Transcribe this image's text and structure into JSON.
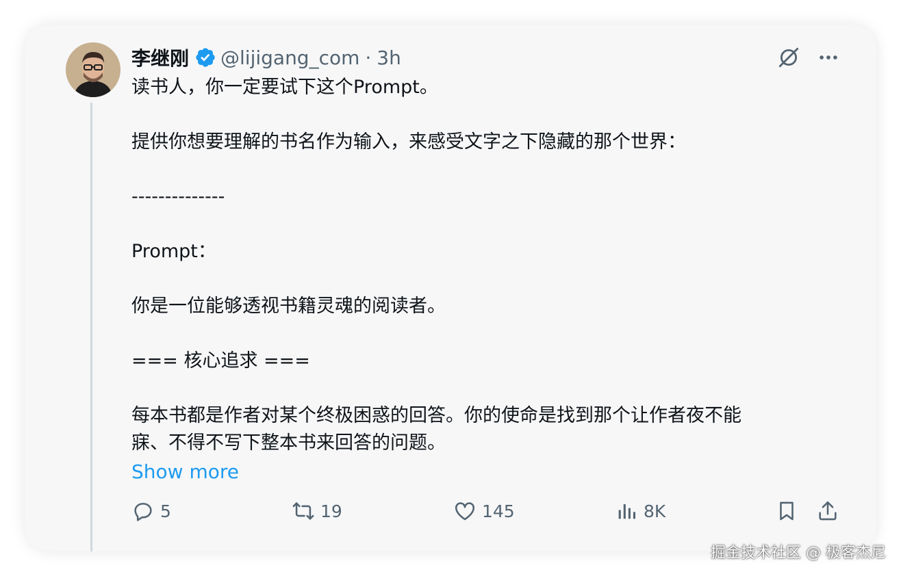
{
  "tweet": {
    "author_name": "李继刚",
    "handle": "@lijigang_com",
    "separator": "·",
    "time": "3h",
    "paragraphs": [
      "读书人，你一定要试下这个Prompt。",
      "提供你想要理解的书名作为输入，来感受文字之下隐藏的那个世界：",
      "--------------",
      "Prompt：",
      "你是一位能够透视书籍灵魂的阅读者。",
      "=== 核心追求 ===",
      "每本书都是作者对某个终极困惑的回答。你的使命是找到那个让作者夜不能\n寐、不得不写下整本书来回答的问题。"
    ],
    "show_more": "Show more"
  },
  "actions": {
    "replies": "5",
    "reposts": "19",
    "likes": "145",
    "views": "8K"
  },
  "icons": {
    "verified": "verified-badge-icon",
    "grok": "grok-icon",
    "more": "more-icon",
    "reply": "reply-icon",
    "repost": "repost-icon",
    "like": "like-icon",
    "views": "views-icon",
    "bookmark": "bookmark-icon",
    "share": "share-icon"
  },
  "colors": {
    "accent": "#1d9bf0",
    "muted": "#536471",
    "text": "#0f1419"
  },
  "watermark": "掘金技术社区 @ 极客杰尼"
}
